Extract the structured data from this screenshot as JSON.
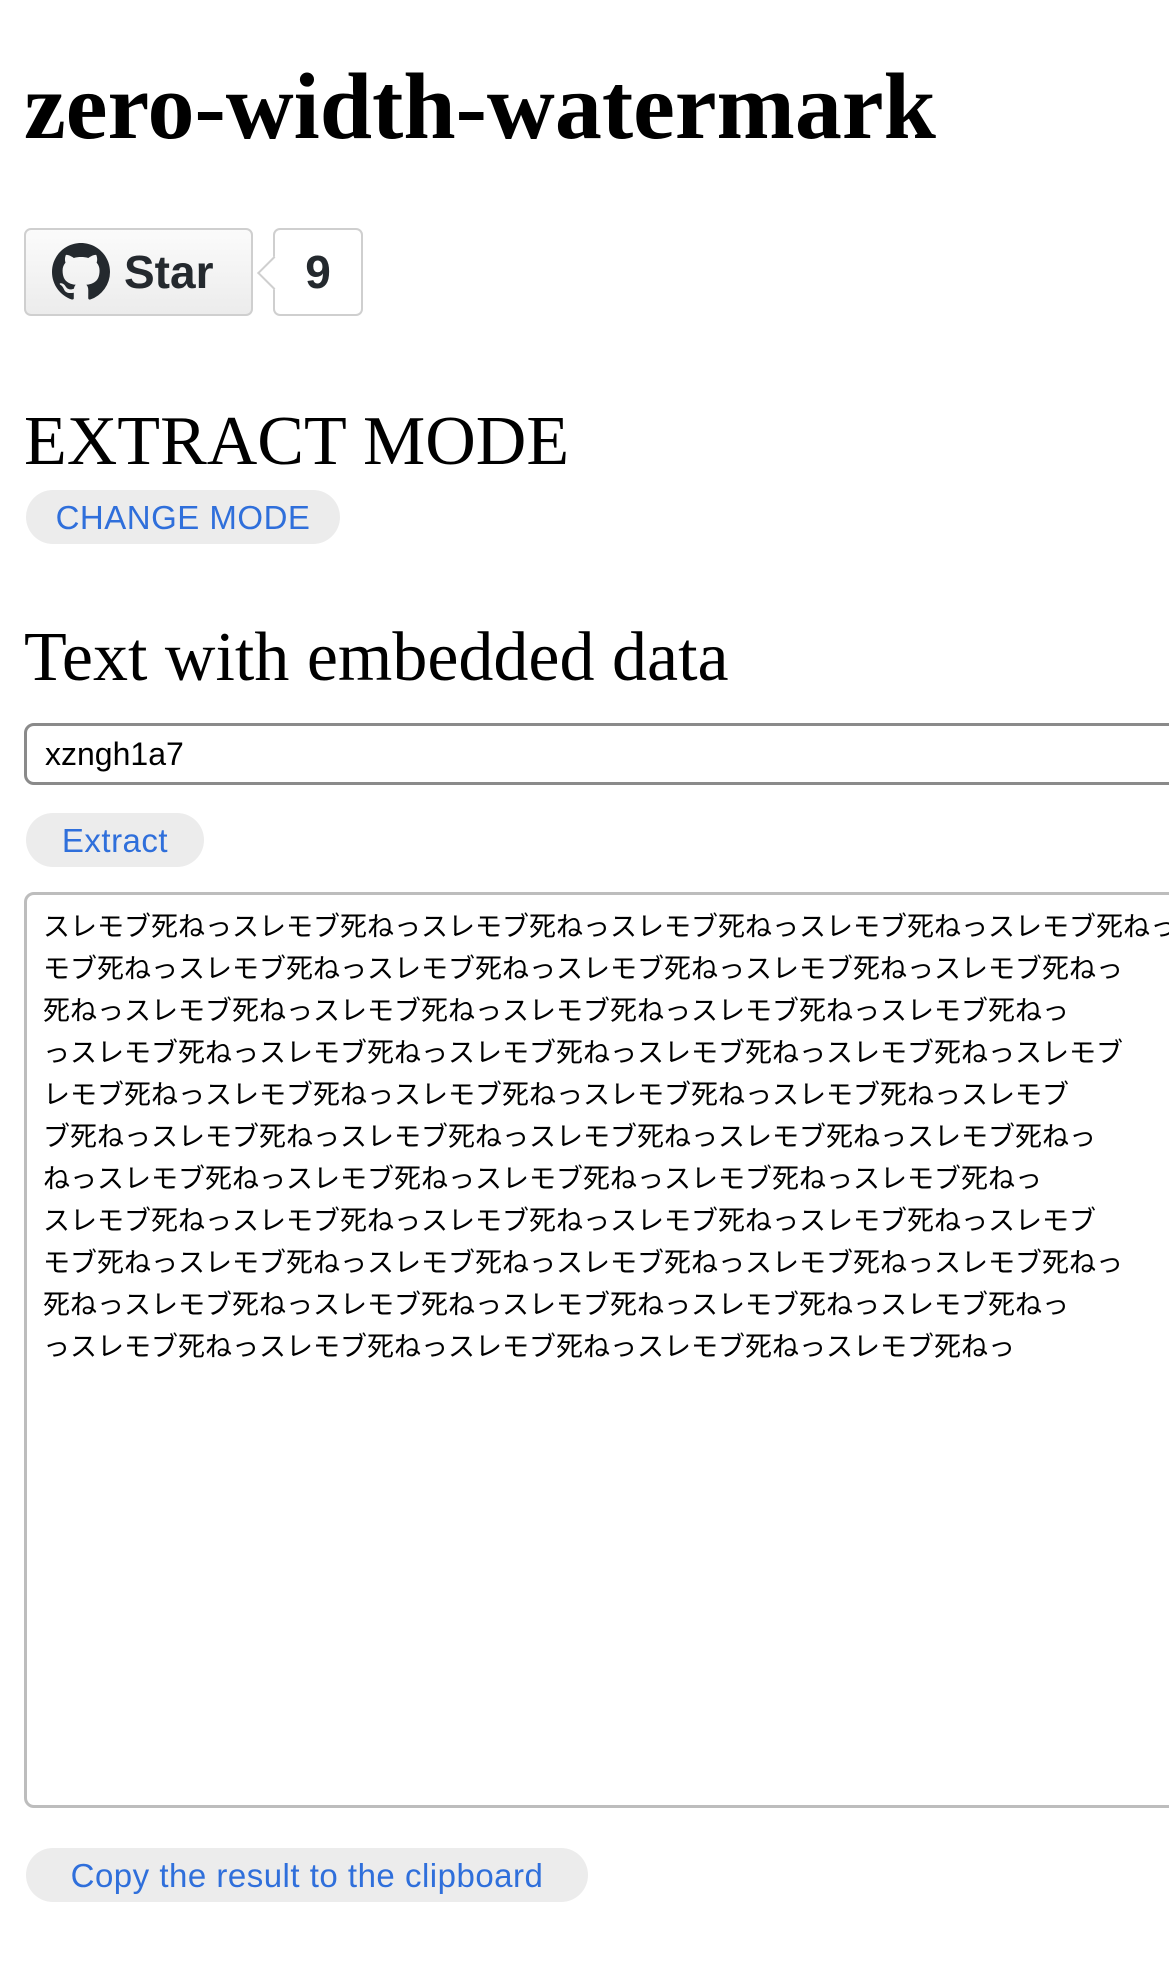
{
  "page": {
    "title": "zero-width-watermark"
  },
  "github": {
    "star_label": "Star",
    "star_count": "9",
    "icon": "github-octocat-icon"
  },
  "mode": {
    "heading": "EXTRACT MODE",
    "change_button": "CHANGE MODE"
  },
  "input": {
    "heading": "Text with embedded data",
    "value": "xzngh1a7",
    "extract_button": "Extract"
  },
  "result": {
    "text": "スレモブ死ねっスレモブ死ねっスレモブ死ねっスレモブ死ねっスレモブ死ねっスレモブ死ねっ\nモブ死ねっスレモブ死ねっスレモブ死ねっスレモブ死ねっスレモブ死ねっスレモブ死ねっ\n死ねっスレモブ死ねっスレモブ死ねっスレモブ死ねっスレモブ死ねっスレモブ死ねっ\nっスレモブ死ねっスレモブ死ねっスレモブ死ねっスレモブ死ねっスレモブ死ねっスレモブ\nレモブ死ねっスレモブ死ねっスレモブ死ねっスレモブ死ねっスレモブ死ねっスレモブ\nブ死ねっスレモブ死ねっスレモブ死ねっスレモブ死ねっスレモブ死ねっスレモブ死ねっ\nねっスレモブ死ねっスレモブ死ねっスレモブ死ねっスレモブ死ねっスレモブ死ねっ\nスレモブ死ねっスレモブ死ねっスレモブ死ねっスレモブ死ねっスレモブ死ねっスレモブ\nモブ死ねっスレモブ死ねっスレモブ死ねっスレモブ死ねっスレモブ死ねっスレモブ死ねっ\n死ねっスレモブ死ねっスレモブ死ねっスレモブ死ねっスレモブ死ねっスレモブ死ねっ\nっスレモブ死ねっスレモブ死ねっスレモブ死ねっスレモブ死ねっスレモブ死ねっ",
    "copy_button": "Copy the result to the clipboard"
  },
  "colors": {
    "link_blue": "#2f6fdb",
    "pill_bg": "#ececec",
    "text": "#000000"
  }
}
